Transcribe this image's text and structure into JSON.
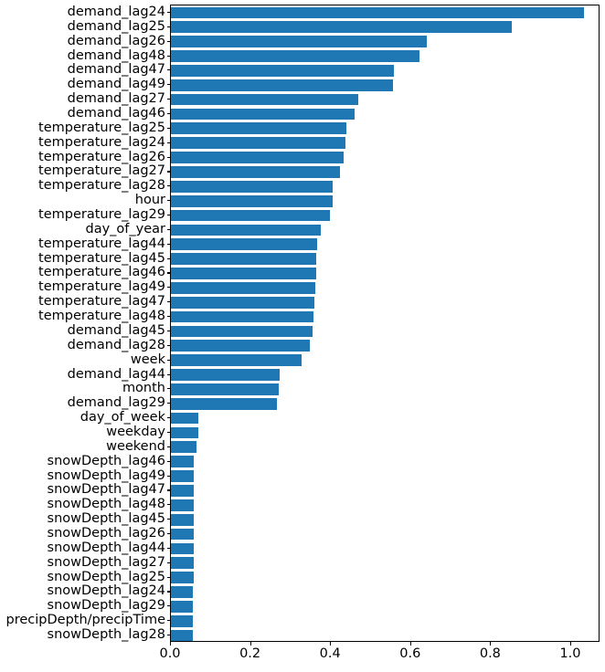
{
  "chart_data": {
    "type": "bar",
    "orientation": "horizontal",
    "title": "",
    "xlabel": "",
    "ylabel": "",
    "xlim": [
      0.0,
      1.0731
    ],
    "xticks": [
      0.0,
      0.2,
      0.4,
      0.6,
      0.8,
      1.0
    ],
    "xtick_labels": [
      "0.0",
      "0.2",
      "0.4",
      "0.6",
      "0.8",
      "1.0"
    ],
    "grid": false,
    "legend": false,
    "bar_color": "#1f77b4",
    "categories": [
      "demand_lag24",
      "demand_lag25",
      "demand_lag26",
      "demand_lag48",
      "demand_lag47",
      "demand_lag49",
      "demand_lag27",
      "demand_lag46",
      "temperature_lag25",
      "temperature_lag24",
      "temperature_lag26",
      "temperature_lag27",
      "temperature_lag28",
      "hour",
      "temperature_lag29",
      "day_of_year",
      "temperature_lag44",
      "temperature_lag45",
      "temperature_lag46",
      "temperature_lag49",
      "temperature_lag47",
      "temperature_lag48",
      "demand_lag45",
      "demand_lag28",
      "week",
      "demand_lag44",
      "month",
      "demand_lag29",
      "day_of_week",
      "weekday",
      "weekend",
      "snowDepth_lag46",
      "snowDepth_lag49",
      "snowDepth_lag47",
      "snowDepth_lag48",
      "snowDepth_lag45",
      "snowDepth_lag26",
      "snowDepth_lag44",
      "snowDepth_lag27",
      "snowDepth_lag25",
      "snowDepth_lag24",
      "snowDepth_lag29",
      "precipDepth/precipTime",
      "snowDepth_lag28"
    ],
    "values": [
      1.032,
      0.852,
      0.639,
      0.62,
      0.556,
      0.554,
      0.468,
      0.459,
      0.438,
      0.436,
      0.431,
      0.422,
      0.405,
      0.404,
      0.398,
      0.374,
      0.366,
      0.364,
      0.362,
      0.36,
      0.358,
      0.356,
      0.353,
      0.348,
      0.327,
      0.272,
      0.27,
      0.265,
      0.068,
      0.068,
      0.065,
      0.058,
      0.058,
      0.057,
      0.057,
      0.057,
      0.056,
      0.056,
      0.056,
      0.056,
      0.055,
      0.055,
      0.055,
      0.055
    ]
  }
}
